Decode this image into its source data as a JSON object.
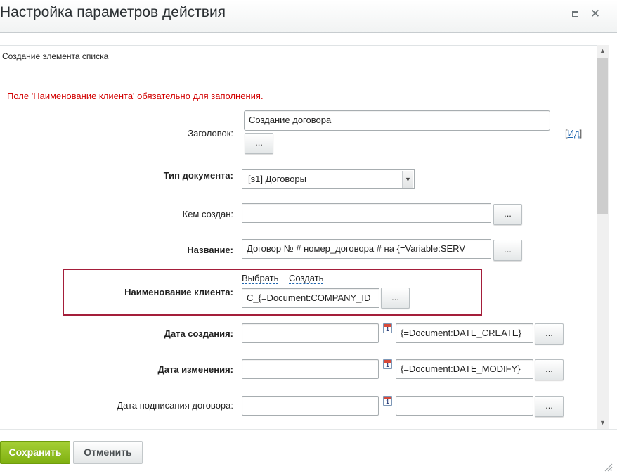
{
  "dialog": {
    "title": "Настройка параметров действия",
    "maximize_icon": "maximize-icon",
    "close_icon": "close-icon",
    "close_glyph": "✕"
  },
  "section": {
    "title": "Создание элемента списка"
  },
  "error_message": "Поле 'Наименование клиента' обязательно для заполнения.",
  "form": {
    "heading": {
      "label": "Заголовок:",
      "value": "Создание договора",
      "button": "...",
      "id_link_open": "[",
      "id_link": "Ид",
      "id_link_close": "]"
    },
    "doc_type": {
      "label": "Тип документа:",
      "selected": "[s1] Договоры"
    },
    "created_by": {
      "label": "Кем создан:",
      "value": "",
      "button": "..."
    },
    "name": {
      "label": "Название:",
      "value": "Договор №  # номер_договора # на  {=Variable:SERV",
      "button": "..."
    },
    "client_name": {
      "label": "Наименование клиента:",
      "select_link": "Выбрать",
      "create_link": "Создать",
      "value": "C_{=Document:COMPANY_ID",
      "button": "..."
    },
    "date_created": {
      "label": "Дата создания:",
      "value": "",
      "expr": "{=Document:DATE_CREATE}",
      "button": "...",
      "cal_num": "1"
    },
    "date_modified": {
      "label": "Дата изменения:",
      "value": "",
      "expr": "{=Document:DATE_MODIFY}",
      "button": "...",
      "cal_num": "1"
    },
    "contract_signed": {
      "label": "Дата подписания договора:",
      "value": "",
      "expr": "",
      "button": "...",
      "cal_num": "1"
    }
  },
  "footer": {
    "save": "Сохранить",
    "cancel": "Отменить"
  },
  "scroll": {
    "up": "▲",
    "down": "▼"
  },
  "colors": {
    "error": "#d20000",
    "save_button": "#8cbd1c",
    "highlight_border": "#a41e3a",
    "link": "#2067b0"
  }
}
